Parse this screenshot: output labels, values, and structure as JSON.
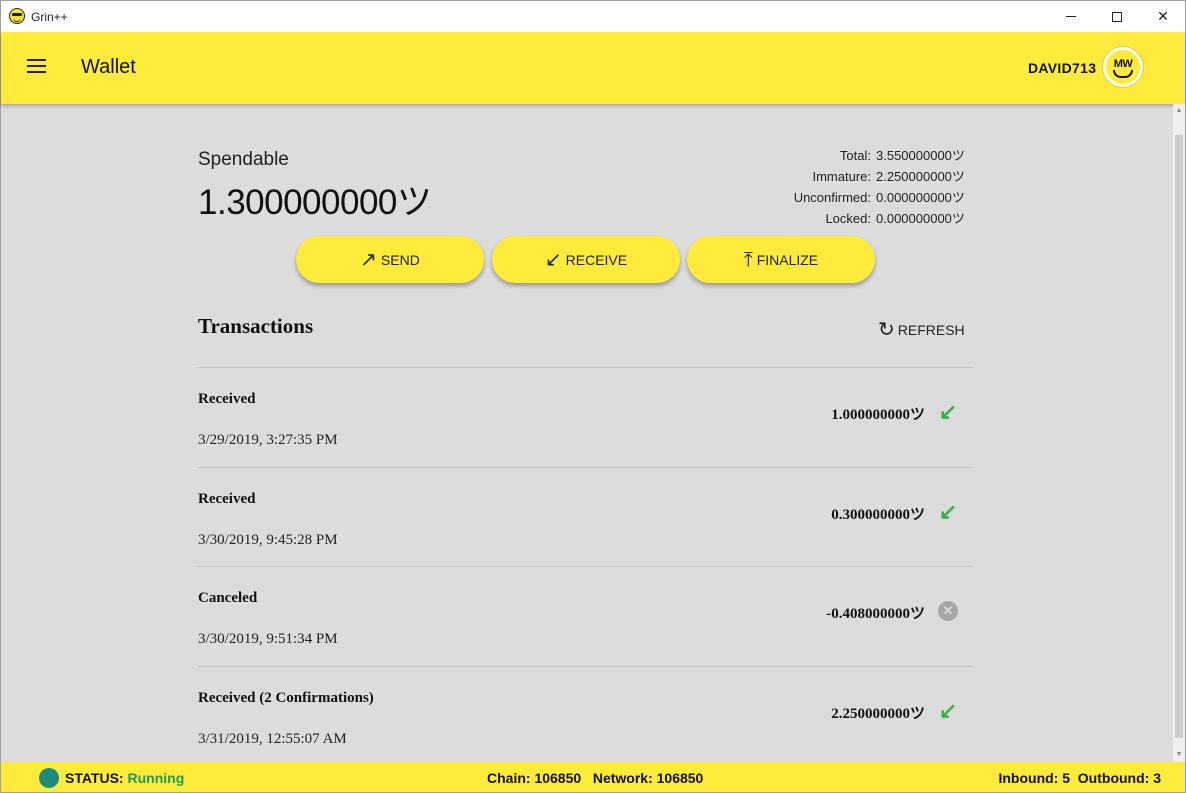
{
  "window": {
    "title": "Grin++"
  },
  "appbar": {
    "title": "Wallet",
    "username": "DAVID713",
    "avatar_text": "MW"
  },
  "balance": {
    "spendable_label": "Spendable",
    "spendable_value": "1.300000000ツ",
    "stats": [
      {
        "label": "Total:",
        "value": "3.550000000ツ"
      },
      {
        "label": "Immature:",
        "value": "2.250000000ツ"
      },
      {
        "label": "Unconfirmed:",
        "value": "0.000000000ツ"
      },
      {
        "label": "Locked:",
        "value": "0.000000000ツ"
      }
    ]
  },
  "actions": {
    "send": "SEND",
    "receive": "RECEIVE",
    "finalize": "FINALIZE"
  },
  "transactions": {
    "heading": "Transactions",
    "refresh": "REFRESH",
    "items": [
      {
        "status": "Received",
        "date": "3/29/2019, 3:27:35 PM",
        "amount": "1.000000000ツ",
        "icon": "received-arrow-icon"
      },
      {
        "status": "Received",
        "date": "3/30/2019, 9:45:28 PM",
        "amount": "0.300000000ツ",
        "icon": "received-arrow-icon"
      },
      {
        "status": "Canceled",
        "date": "3/30/2019, 9:51:34 PM",
        "amount": "-0.408000000ツ",
        "icon": "canceled-icon"
      },
      {
        "status": "Received (2 Confirmations)",
        "date": "3/31/2019, 12:55:07 AM",
        "amount": "2.250000000ツ",
        "icon": "received-arrow-icon"
      }
    ]
  },
  "statusbar": {
    "status_label": "STATUS:",
    "status_value": "Running",
    "chain": "Chain: 106850",
    "network": "Network: 106850",
    "inbound": "Inbound: 5",
    "outbound": "Outbound: 3"
  },
  "colors": {
    "accent": "#ffeb3b",
    "background": "#dcdcdc",
    "received": "#3cb04a",
    "status_running": "#1e9a5a"
  }
}
